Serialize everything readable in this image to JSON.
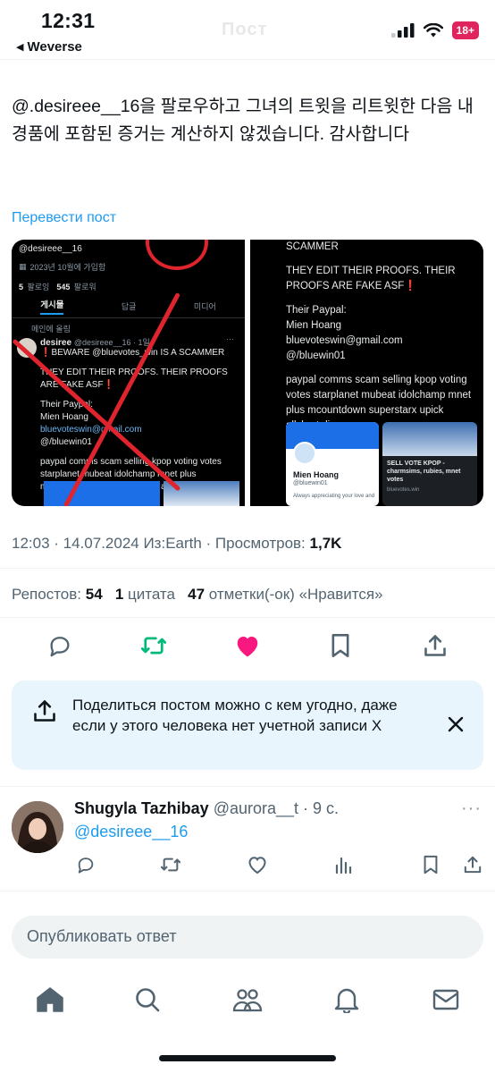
{
  "status_bar": {
    "time": "12:31",
    "back_app": "Weverse",
    "battery": "18+",
    "blurred_title": "Пост"
  },
  "tweet": {
    "text": "@.desireee__16을 팔로우하고 그녀의 트윗을 리트윗한 다음 내 경품에 포함된 증거는 계산하지 않겠습니다. 감사합니다",
    "translate_label": "Перевести пост",
    "meta_time": "12:03 · 14.07.2024 Из:Earth · Просмотров: ",
    "meta_views": "1,7K",
    "reposts_label": "Репостов: ",
    "reposts_count": "54",
    "quotes_count": "1",
    "quotes_label": " цитата",
    "likes_count": "47",
    "likes_label": " отметки(-ок) «Нравится»"
  },
  "media_left": {
    "handle": "@desireee__16",
    "joined": "2023년 10월에 가입함",
    "following": "5",
    "following_label": "팔로잉",
    "followers": "545",
    "followers_label": "팔로워",
    "tabs": [
      "게시물",
      "답글",
      "미디어"
    ],
    "pinned": "메인에 올림",
    "post_name": "desiree",
    "post_handle": "@desireee__16 · 1일",
    "post_lines": [
      "❗BEWARE @bluevotes_win IS A SCAMMER",
      "THEY EDIT THEIR PROOFS. THEIR PROOFS ARE FAKE ASF❗",
      "Their Paypal:",
      "Mien Hoang",
      "bluevoteswin@gmail.com",
      "@/bluewin01",
      "paypal comms scam selling kpop voting votes starplanet mubeat idolchamp mnet plus mcountdown superstarx upick allchart diggus"
    ]
  },
  "media_right": {
    "lines": [
      "SCAMMER",
      "THEY EDIT THEIR PROOFS. THEIR PROOFS ARE FAKE ASF❗",
      "Their Paypal:",
      "Mien Hoang",
      "bluevoteswin@gmail.com",
      "@/bluewin01",
      "paypal comms scam selling kpop voting votes starplanet mubeat idolchamp mnet plus mcountdown superstarx upick allchart diggus"
    ],
    "card_name": "Mien Hoang",
    "card_handle": "@bluewin01",
    "card_caption": "Always appreciating your love and",
    "card2_title": "SELL VOTE KPOP - charmsims, rubies, mnet votes",
    "card2_sub": "bluevotes.win"
  },
  "share_banner": {
    "text": "Поделиться постом можно с кем угодно, даже если у этого человека нет учетной записи X"
  },
  "reply": {
    "name": "Shugyla Tazhibay",
    "handle": "@aurora__t · 9 с.",
    "body": "@desireee__16"
  },
  "compose": {
    "placeholder": "Опубликовать ответ"
  },
  "colors": {
    "accent": "#1d9bf0",
    "repost_green": "#00ba7c",
    "like_pink": "#f91880",
    "cross_red": "#e0242d"
  }
}
